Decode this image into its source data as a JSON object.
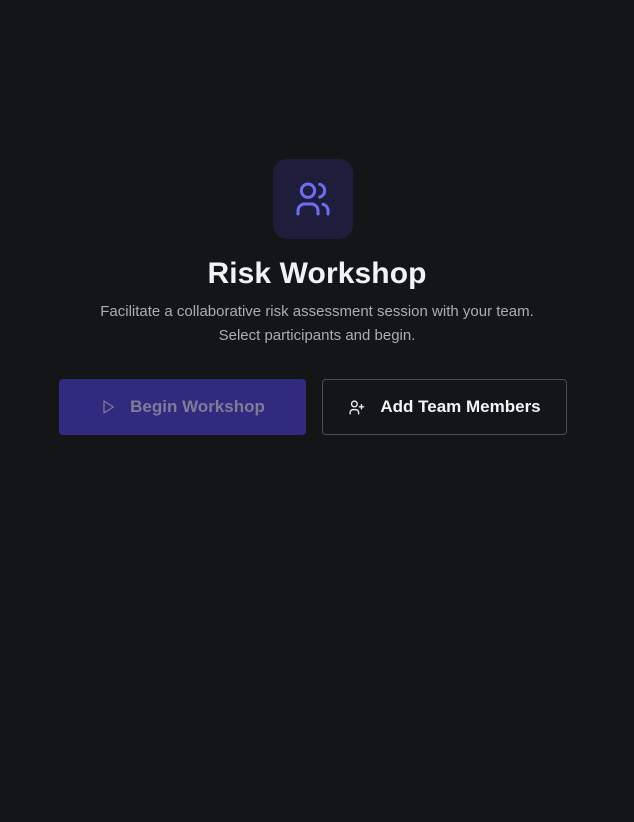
{
  "hero": {
    "icon": "users-icon",
    "title": "Risk Workshop",
    "subtitle": "Facilitate a collaborative risk assessment session with your team. Select participants and begin."
  },
  "actions": {
    "begin": {
      "label": "Begin Workshop",
      "icon": "play-icon",
      "state": "disabled"
    },
    "add_members": {
      "label": "Add Team Members",
      "icon": "user-plus-icon"
    }
  },
  "colors": {
    "background": "#141517",
    "accent": "#6366f1",
    "icon_tile": "#1e1d3b",
    "primary_button": "#312b7f"
  }
}
